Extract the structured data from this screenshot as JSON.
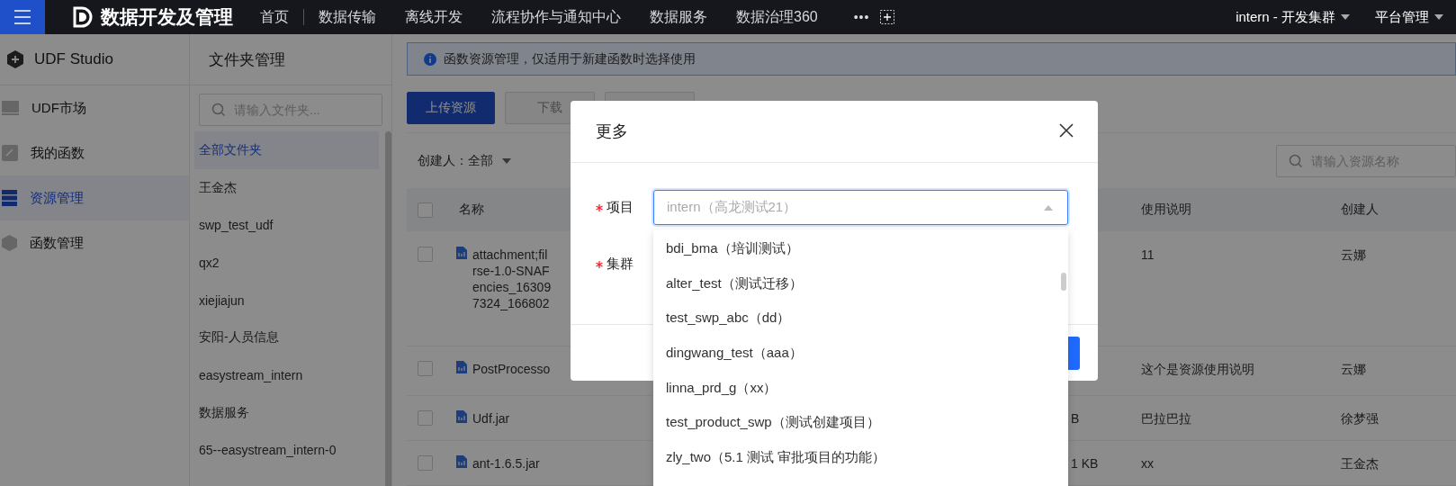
{
  "nav": {
    "brand": "数据开发及管理",
    "items": [
      {
        "label": "首页",
        "selected": false
      },
      {
        "label": "数据传输",
        "selected": false
      },
      {
        "label": "离线开发",
        "selected": false
      },
      {
        "label": "流程协作与通知中心",
        "selected": false
      },
      {
        "label": "数据服务",
        "selected": false
      },
      {
        "label": "数据治理360",
        "selected": false
      }
    ],
    "more": "•••",
    "cluster": "intern - 开发集群",
    "admin": "平台管理"
  },
  "sidebar": {
    "title": "UDF Studio",
    "items": [
      {
        "label": "UDF市场",
        "kind": "market",
        "selected": false
      },
      {
        "label": "我的函数",
        "kind": "function",
        "selected": false
      },
      {
        "label": "资源管理",
        "kind": "resource",
        "selected": true
      },
      {
        "label": "函数管理",
        "kind": "manage",
        "selected": false
      }
    ]
  },
  "folders": {
    "title": "文件夹管理",
    "placeholder": "请输入文件夹...",
    "items": [
      {
        "label": "全部文件夹",
        "selected": true
      },
      {
        "label": "王金杰",
        "selected": false
      },
      {
        "label": "swp_test_udf",
        "selected": false
      },
      {
        "label": "qx2",
        "selected": false
      },
      {
        "label": "xiejiajun",
        "selected": false
      },
      {
        "label": "安阳-人员信息",
        "selected": false
      },
      {
        "label": "easystream_intern",
        "selected": false
      },
      {
        "label": "数据服务",
        "selected": false
      },
      {
        "label": "65--easystream_intern-0",
        "selected": false
      }
    ]
  },
  "alert": "函数资源管理，仅适用于新建函数时选择使用",
  "toolbar": {
    "buttons": [
      {
        "kind": "primary",
        "label": "上传资源"
      },
      {
        "kind": "disabled",
        "label": "下载"
      },
      {
        "kind": "disabled"
      }
    ],
    "filter": "创建人：全部",
    "search_placeholder": "请输入资源名称"
  },
  "table": {
    "select_all": {
      "checked": false
    },
    "columns": {
      "name": "名称",
      "column_4": "使用说明",
      "column_5": "创建人"
    },
    "rows": [
      {
        "checked": false,
        "name_lines": [
          "attachment;fil",
          "rse-1.0-SNAF",
          "encies_16309",
          "7324_166802"
        ],
        "description": "11",
        "creator": "云娜"
      },
      {
        "checked": false,
        "name_lines": [
          "PostProcesso"
        ],
        "description": "这个是资源使用说明",
        "creator": "云娜"
      },
      {
        "checked": false,
        "name_lines": [
          "Udf.jar"
        ],
        "size": "B",
        "description": "巴拉巴拉",
        "creator": "徐梦强"
      },
      {
        "checked": false,
        "name_lines": [
          "ant-1.6.5.jar"
        ],
        "size": "1 KB",
        "description": "xx",
        "creator": "王金杰"
      }
    ]
  },
  "modal": {
    "title": "更多",
    "fields": [
      {
        "label": "项目",
        "required": true,
        "placeholder": "intern（高龙测试21）",
        "expanded": true
      },
      {
        "label": "集群",
        "required": true
      }
    ],
    "options": [
      "bdi_bma（培训测试）",
      "alter_test（测试迁移）",
      "test_swp_abc（dd）",
      "dingwang_test（aaa）",
      "linna_prd_g（xx）",
      "test_product_swp（测试创建项目）",
      "zly_two（5.1 测试 审批项目的功能）"
    ]
  }
}
